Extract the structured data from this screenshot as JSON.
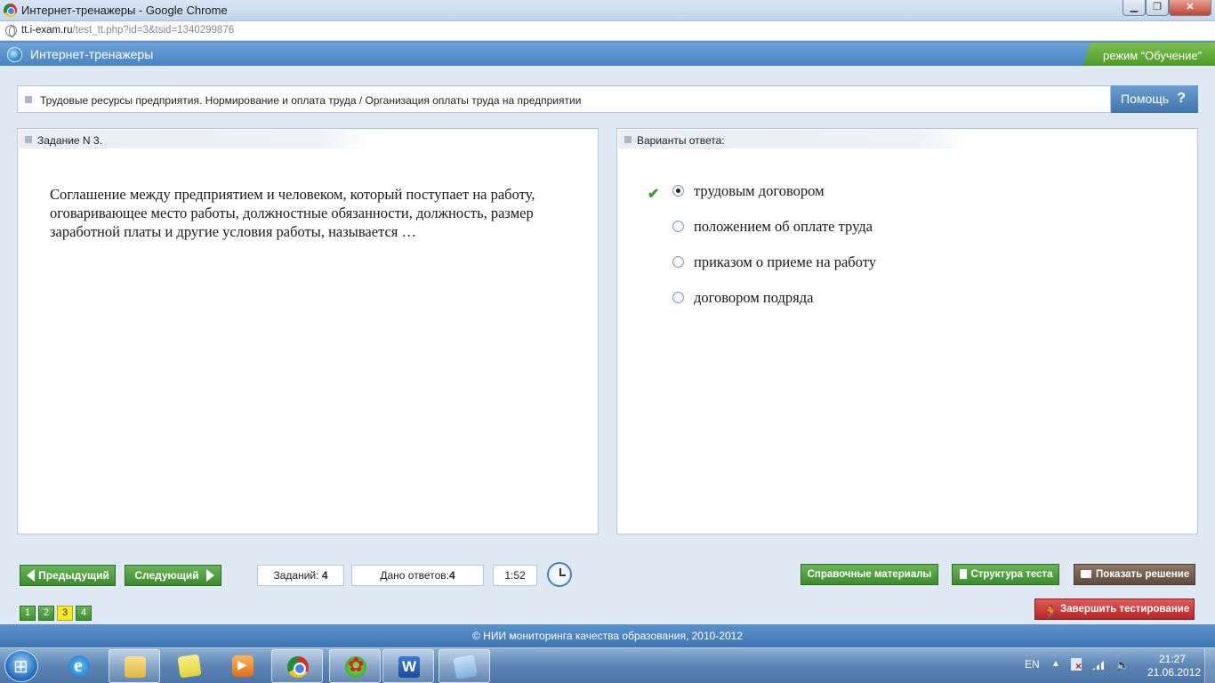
{
  "window": {
    "title": "Интернет-тренажеры - Google Chrome",
    "minimize_label": "▁",
    "maximize_label": "❐",
    "close_label": "✕"
  },
  "address": {
    "host": "tt.i-exam.ru",
    "path": "/test_tt.php?id=3&tsid=1340299876"
  },
  "site": {
    "title": "Интернет-тренажеры",
    "mode": "режим “Обучение”"
  },
  "topic": {
    "text": "Трудовые ресурсы предприятия. Нормирование и оплата труда / Организация оплаты труда на предприятии"
  },
  "help": {
    "label": "Помощь",
    "icon_text": "?"
  },
  "task": {
    "header": "Задание N 3.",
    "question": "Соглашение между предприятием и человеком, который поступает на работу, оговаривающее место работы, должностные обязанности, должность, размер заработной платы и другие условия работы, называется …"
  },
  "answers": {
    "header": "Варианты ответа:",
    "check_icon": "✔",
    "items": [
      {
        "text": "трудовым договором",
        "selected": true
      },
      {
        "text": "положением об оплате труда",
        "selected": false
      },
      {
        "text": "приказом о приеме на работу",
        "selected": false
      },
      {
        "text": "договором подряда",
        "selected": false
      }
    ]
  },
  "toolbar": {
    "prev_label": "Предыдущий",
    "next_label": "Следующий",
    "tasks_label": "Заданий: ",
    "tasks_value": "4",
    "answers_label": "Дано ответов:",
    "answers_value": "4",
    "timer": "1:52",
    "reference_label": "Справочные материалы",
    "structure_label": "Структура теста",
    "solution_label": "Показать решение",
    "finish_label": "Завершить тестирование"
  },
  "pager": {
    "pages": [
      "1",
      "2",
      "3",
      "4"
    ],
    "current_page": "3"
  },
  "footer": {
    "text": "© НИИ мониторинга качества образования, 2010-2012"
  },
  "taskbar": {
    "lang": "EN",
    "tray_up": "▲",
    "volume_icon": "🔈",
    "time": "21:27",
    "date": "21.06.2012",
    "apps": [
      "internet-explorer",
      "windows-explorer",
      "sticky-notes",
      "media-player",
      "google-chrome",
      "icq",
      "microsoft-word",
      "paint"
    ]
  },
  "colors": {
    "accent_blue": "#4a83c2",
    "accent_green": "#4e9a2a",
    "finish_red": "#b52626",
    "solution_brown": "#5e4a3b",
    "page_active": "#f5ea2a"
  }
}
